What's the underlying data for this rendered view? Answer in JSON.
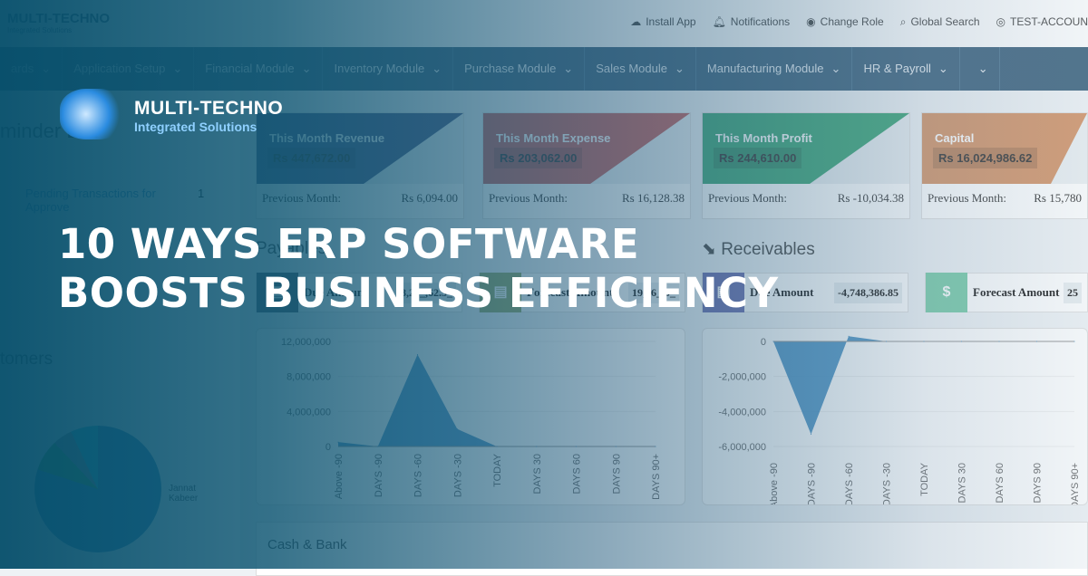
{
  "topbar": {
    "logo": "MULTI-TECHNO",
    "logo_sub": "Integrated Solutions",
    "links": [
      {
        "icon": "cloud-download-icon",
        "label": "Install App"
      },
      {
        "icon": "bell-icon",
        "label": "Notifications"
      },
      {
        "icon": "user-switch-icon",
        "label": "Change Role"
      },
      {
        "icon": "search-icon",
        "label": "Global Search"
      },
      {
        "icon": "user-circle-icon",
        "label": "TEST-ACCOUN"
      }
    ]
  },
  "nav": [
    "ards",
    "Application Setup",
    "Financial Module",
    "Inventory Module",
    "Purchase Module",
    "Sales Module",
    "Manufacturing Module",
    "HR & Payroll",
    ""
  ],
  "left": {
    "reminder_title": "minder List",
    "pending": "Pending Transactions for Approve",
    "pending_count": "1",
    "customers": "tomers",
    "pie_label": "Jannat Kabeer"
  },
  "cards": [
    {
      "title": "This Month Revenue",
      "value": "Rs 447,672.00",
      "prev_label": "Previous Month:",
      "prev": "Rs 6,094.00",
      "color": "#3b4a7a"
    },
    {
      "title": "This Month Expense",
      "value": "Rs 203,062.00",
      "prev_label": "Previous Month:",
      "prev": "Rs 16,128.38",
      "color": "#c0504d"
    },
    {
      "title": "This Month Profit",
      "value": "Rs 244,610.00",
      "prev_label": "Previous Month:",
      "prev": "Rs -10,034.38",
      "color": "#2a9d6a"
    },
    {
      "title": "Capital",
      "value": "Rs 16,024,986.62",
      "prev_label": "Previous Month:",
      "prev": "Rs 15,780",
      "color": "#d08a5a"
    }
  ],
  "payables": {
    "title": "Payables",
    "items": [
      {
        "label": "Due Amount",
        "amount": "8,21_,62.5_",
        "color": "#3d4a5a"
      },
      {
        "label": "Forecast Amount",
        "amount": "19,26_.0_",
        "color": "#8aa05a"
      }
    ]
  },
  "receivables": {
    "title": "Receivables",
    "items": [
      {
        "label": "Due Amount",
        "amount": "-4,748,386.85",
        "color": "#5b5ea6"
      },
      {
        "label": "Forecast Amount",
        "amount": "25",
        "color": "#6cc7a0",
        "icon": "$"
      }
    ]
  },
  "cash_bank": "Cash & Bank",
  "brand": {
    "name": "MULTI-TECHNO",
    "tagline": "Integrated Solutions"
  },
  "headline": [
    "10 WAYS ERP SOFTWARE",
    "BOOSTS BUSINESS EFFICIENCY"
  ],
  "chart_data": [
    {
      "type": "area",
      "title": "Payables",
      "categories": [
        "Above -90",
        "DAYS -90",
        "DAYS -60",
        "DAYS -30",
        "TODAY",
        "DAYS 30",
        "DAYS 60",
        "DAYS 90",
        "DAYS 90+"
      ],
      "values": [
        500000,
        0,
        10500000,
        2000000,
        0,
        0,
        0,
        0,
        0
      ],
      "ylim": [
        0,
        12000000
      ],
      "yticks": [
        "0",
        "4,000,000",
        "8,000,000",
        "12,000,000"
      ],
      "color": "#1f77b4"
    },
    {
      "type": "area",
      "title": "Receivables",
      "categories": [
        "Above -90",
        "DAYS -90",
        "DAYS -60",
        "DAYS -30",
        "TODAY",
        "DAYS 30",
        "DAYS 60",
        "DAYS 90",
        "DAYS 90+"
      ],
      "values": [
        0,
        -5300000,
        300000,
        0,
        0,
        0,
        0,
        0,
        0
      ],
      "ylim": [
        -6000000,
        0
      ],
      "yticks": [
        "0",
        "-2,000,000",
        "-4,000,000",
        "-6,000,000"
      ],
      "color": "#1f77b4"
    }
  ]
}
